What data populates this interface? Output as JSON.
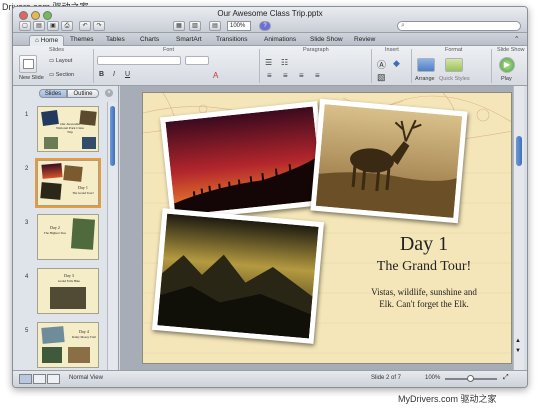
{
  "watermark_top": "Drivers.com 驱动之家",
  "watermark_bottom": "MyDrivers.com 驱动之家",
  "window": {
    "title": "Our Awesome Class Trip.pptx"
  },
  "toolbar": {
    "zoom": "100%",
    "search_placeholder": ""
  },
  "ribbon": {
    "tabs": [
      "Home",
      "Themes",
      "Tables",
      "Charts",
      "SmartArt",
      "Transitions",
      "Animations",
      "Slide Show",
      "Review"
    ],
    "groups": [
      "Slides",
      "Font",
      "Paragraph",
      "Insert",
      "Format",
      "Slide Show"
    ],
    "buttons": {
      "new_slide": "New Slide",
      "layout": "Layout",
      "section": "Section",
      "arrange": "Arrange",
      "quick_styles": "Quick Styles",
      "play": "Play"
    }
  },
  "panel": {
    "view_slides": "Slides",
    "view_outline": "Outline",
    "slides": [
      {
        "num": "1",
        "title": "Our Awesome National Park Class Trip"
      },
      {
        "num": "2",
        "title": "Day 1",
        "subtitle": "The Grand Tour!"
      },
      {
        "num": "3",
        "title": "Day 2",
        "subtitle": "The Highest Tree"
      },
      {
        "num": "4",
        "title": "Day 3",
        "subtitle": "Grand Falls Hike"
      },
      {
        "num": "5",
        "title": "Day 4",
        "subtitle": "Rainy Mosey Trail"
      }
    ]
  },
  "slide": {
    "title": "Day 1",
    "subtitle": "The Grand Tour!",
    "body_line1": "Vistas, wildlife, sunshine and",
    "body_line2": "Elk. Can't forget the Elk."
  },
  "status": {
    "view": "Normal View",
    "page": "Slide 2 of 7",
    "zoom": "100%"
  },
  "colors": {
    "selection": "#e99a3a",
    "slide_bg": "#f4e6b8"
  }
}
